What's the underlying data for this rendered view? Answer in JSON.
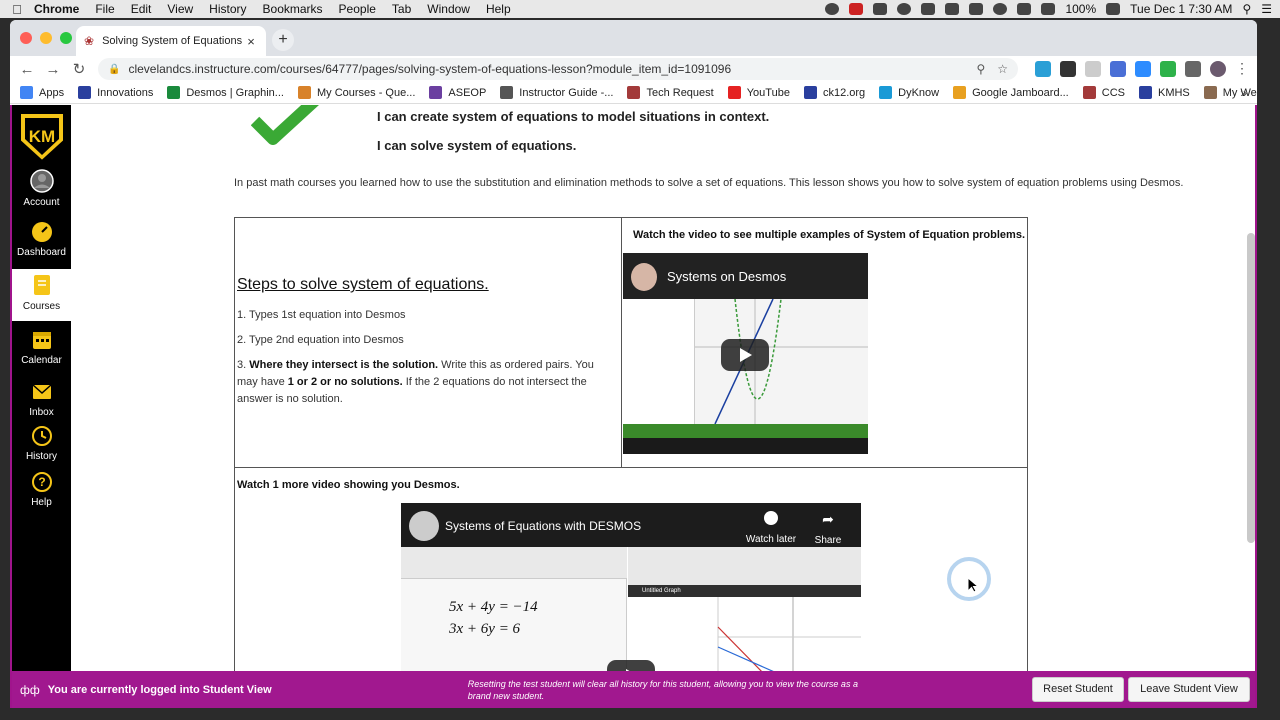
{
  "menubar": {
    "app_name": "Chrome",
    "items": [
      "File",
      "Edit",
      "View",
      "History",
      "Bookmarks",
      "People",
      "Tab",
      "Window",
      "Help"
    ],
    "battery": "100%",
    "clock": "Tue Dec 1  7:30 AM"
  },
  "browser": {
    "tab_title": "Solving System of Equations Le",
    "url": "clevelandcs.instructure.com/courses/64777/pages/solving-system-of-equations-lesson?module_item_id=1091096",
    "bookmarks": [
      {
        "label": "Apps",
        "color": "#4285f4"
      },
      {
        "label": "Innovations",
        "color": "#2a3f9e"
      },
      {
        "label": "Desmos | Graphin...",
        "color": "#1a8a3c"
      },
      {
        "label": "My Courses - Que...",
        "color": "#d8822a"
      },
      {
        "label": "ASEOP",
        "color": "#6b3fa0"
      },
      {
        "label": "Instructor Guide -...",
        "color": "#555555"
      },
      {
        "label": "Tech Request",
        "color": "#a33a3a"
      },
      {
        "label": "YouTube",
        "color": "#e52222"
      },
      {
        "label": "ck12.org",
        "color": "#2a3f9e"
      },
      {
        "label": "DyKnow",
        "color": "#1a9ad6"
      },
      {
        "label": "Google Jamboard...",
        "color": "#e8a020"
      },
      {
        "label": "CCS",
        "color": "#a33a3a"
      },
      {
        "label": "KMHS",
        "color": "#2a3f9e"
      },
      {
        "label": "My Website",
        "color": "#8a6a50"
      }
    ]
  },
  "global_nav": {
    "items": [
      {
        "label": "Account",
        "icon": "account-icon"
      },
      {
        "label": "Dashboard",
        "icon": "dashboard-icon"
      },
      {
        "label": "Courses",
        "icon": "courses-icon"
      },
      {
        "label": "Calendar",
        "icon": "calendar-icon"
      },
      {
        "label": "Inbox",
        "icon": "inbox-icon"
      },
      {
        "label": "History",
        "icon": "history-icon"
      },
      {
        "label": "Help",
        "icon": "help-icon"
      }
    ],
    "logo_text": "KM"
  },
  "lesson": {
    "objectives": [
      "I can create system of equations to model  situations in context.",
      "I can solve system of equations."
    ],
    "intro": "In past math courses you learned how to use the substitution and elimination methods to solve a set of equations.  This lesson shows you how to solve system of equation problems using Desmos.",
    "steps_title": "Steps to solve system of equations.",
    "step1": "1. Types 1st equation into Desmos",
    "step2": "2. Type 2nd equation into Desmos",
    "step3_prefix": "3.  ",
    "step3_bold1": "Where they intersect is the solution.",
    "step3_mid": "  Write this as ordered pairs.  You may have ",
    "step3_bold2": "1 or 2 or no solutions.",
    "step3_end": "  If the 2 equations do not intersect the answer is no solution.",
    "watch_video_1": "Watch the video to see multiple examples of System of Equation problems.",
    "video1_title": "Systems on Desmos",
    "watch_video_2": "Watch 1 more video showing you Desmos.",
    "video2_title": "Systems of Equations with DESMOS",
    "video2_watch_later": "Watch later",
    "video2_share": "Share",
    "eq1": "5x + 4y = −14",
    "eq2": "3x + 6y = 6",
    "desmos_graph_title": "Untitled Graph"
  },
  "student_view": {
    "message": "You are currently logged into Student View",
    "note": "Resetting the test student will clear all history for this student, allowing you to view the course as a brand new student.",
    "reset_label": "Reset Student",
    "leave_label": "Leave Student View"
  },
  "colors": {
    "canvas_border": "#a0148c",
    "student_bar": "#a1188f",
    "nav_bg": "#000000",
    "nav_yellow": "#f5c518"
  }
}
